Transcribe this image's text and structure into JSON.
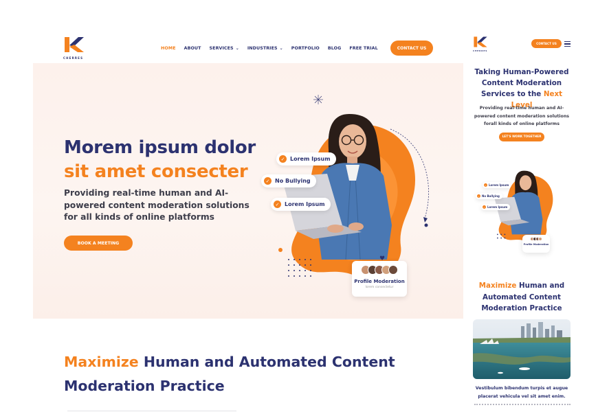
{
  "brand": {
    "name": "CHERRES"
  },
  "nav": {
    "items": [
      {
        "label": "HOME",
        "active": true,
        "has_dropdown": false
      },
      {
        "label": "ABOUT",
        "active": false,
        "has_dropdown": false
      },
      {
        "label": "SERVICES",
        "active": false,
        "has_dropdown": true
      },
      {
        "label": "INDUSTRIES",
        "active": false,
        "has_dropdown": true
      },
      {
        "label": "PORTFOLIO",
        "active": false,
        "has_dropdown": false
      },
      {
        "label": "BLOG",
        "active": false,
        "has_dropdown": false
      },
      {
        "label": "FREE TRIAL",
        "active": false,
        "has_dropdown": false
      }
    ],
    "contact_label": "CONTACT US"
  },
  "hero": {
    "title_line1": "Morem ipsum dolor",
    "title_line2": "sit amet consecter",
    "subtitle": "Providing real-time human and AI-powered content moderation solutions for all kinds of online platforms",
    "cta_label": "BOOK A MEETING",
    "chips": [
      "Lorem Ipsum",
      "No Bullying",
      "Lorem Ipsum"
    ],
    "profile_card": {
      "title": "Profile Moderation",
      "subtitle": "lorem consectetur"
    }
  },
  "section2": {
    "title_highlight": "Maximize",
    "title_line1_rest": " Human and Automated Content",
    "title_line2": "Moderation Practice"
  },
  "mobile": {
    "contact_label": "CONTACT US",
    "hero_title_a": "Taking Human-Powered Content Moderation Services to the ",
    "hero_title_highlight": "Next Level",
    "hero_subtitle": "Providing real-time human and AI-powered content moderation solutions forall kinds of online platforms",
    "cta_label": "LET'S WORK TOGETHER",
    "chips": [
      "Lorem Ipsum",
      "No Bullying",
      "Lorem Ipsum"
    ],
    "profile_card_title": "Profile Moderation",
    "section2_highlight": "Maximize",
    "section2_rest": " Human and Automated Content Moderation Practice",
    "photo_caption": "Vestibulum bibendum turpis et augue placerat vehicula vel sit amet enim."
  },
  "colors": {
    "accent": "#f4821f",
    "navy": "#2c3270",
    "hero_bg": "#fdf1ec"
  }
}
